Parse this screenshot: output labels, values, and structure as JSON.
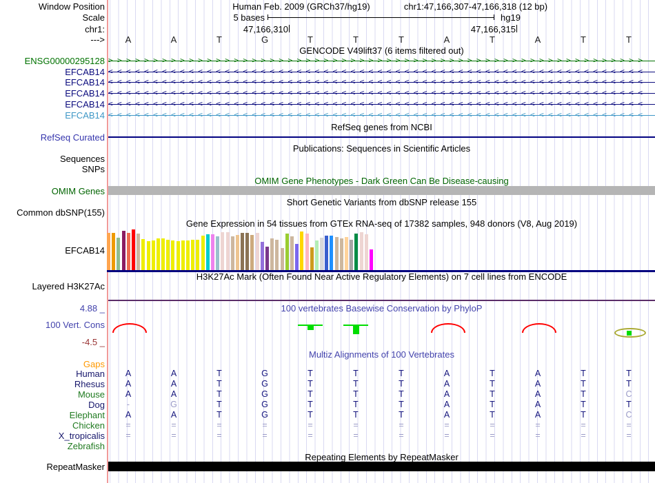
{
  "header": {
    "assembly": "Human Feb. 2009 (GRCh37/hg19)",
    "position": "chr1:47,166,307-47,166,318 (12 bp)",
    "scale_label": "5 bases",
    "genome": "hg19",
    "ruler_tick_left": "47,166,310",
    "ruler_tick_right": "47,166,315",
    "strand": "--->",
    "row_labels": {
      "window_position": "Window Position",
      "scale": "Scale",
      "chromosome": "chr1:"
    }
  },
  "sequence": {
    "bases": [
      "A",
      "A",
      "T",
      "G",
      "T",
      "T",
      "T",
      "A",
      "T",
      "A",
      "T",
      "T"
    ]
  },
  "tracks": {
    "gencode": {
      "title": "GENCODE V49lift37 (6 items filtered out)",
      "genes": [
        {
          "label": "ENSG00000295128",
          "color": "#007200",
          "direction": ">"
        },
        {
          "label": "EFCAB14",
          "color": "#0B0B7E",
          "direction": "<"
        },
        {
          "label": "EFCAB14",
          "color": "#0B0B7E",
          "direction": "<"
        },
        {
          "label": "EFCAB14",
          "color": "#0B0B7E",
          "direction": "<"
        },
        {
          "label": "EFCAB14",
          "color": "#0B0B7E",
          "direction": "<"
        },
        {
          "label": "EFCAB14",
          "color": "#3E97C6",
          "direction": "<"
        }
      ]
    },
    "refseq": {
      "title": "RefSeq genes from NCBI",
      "label": "RefSeq Curated",
      "label_color": "#3535AD",
      "line_color": "#000080"
    },
    "publications": {
      "title": "Publications: Sequences in Scientific Articles",
      "label_sequences": "Sequences",
      "label_snps": "SNPs"
    },
    "omim": {
      "title": "OMIM Gene Phenotypes - Dark Green Can Be Disease-causing",
      "label": "OMIM Genes",
      "color": "#006400",
      "bar_color": "#B5B5B5"
    },
    "dbsnp": {
      "title": "Short Genetic Variants from dbSNP release 155",
      "label": "Common dbSNP(155)"
    },
    "gtex": {
      "title": "Gene Expression in 54 tissues from GTEx RNA-seq of 17382 samples, 948 donors (V8, Aug 2019)",
      "label": "EFCAB14"
    },
    "h3k27ac": {
      "title": "H3K27Ac Mark (Often Found Near Active Regulatory Elements) on 7 cell lines from ENCODE",
      "label": "Layered H3K27Ac",
      "line_color": "#5B2D68"
    },
    "phylop": {
      "title": "100 vertebrates Basewise Conservation by PhyloP",
      "label": "100 Vert. Cons",
      "max_label": "4.88 _",
      "min_label": "-4.5 _",
      "features": [
        {
          "type": "arc",
          "x": 29
        },
        {
          "type": "tick",
          "x": 293,
          "h": 7
        },
        {
          "type": "tick",
          "x": 359,
          "h": 13
        },
        {
          "type": "arc",
          "x": 491
        },
        {
          "type": "arc",
          "x": 623
        },
        {
          "type": "oval",
          "x": 755
        }
      ]
    },
    "multiz": {
      "title": "Multiz Alignments of 100 Vertebrates",
      "rows": [
        {
          "species": "Gaps",
          "color": "#FF9900",
          "cells": [
            "",
            "",
            "",
            "",
            "",
            "",
            "",
            "",
            "",
            "",
            "",
            ""
          ],
          "dim": []
        },
        {
          "species": "Human",
          "color": "#16166B",
          "cells": [
            "A",
            "A",
            "T",
            "G",
            "T",
            "T",
            "T",
            "A",
            "T",
            "A",
            "T",
            "T"
          ],
          "dim": []
        },
        {
          "species": "Rhesus",
          "color": "#16166B",
          "cells": [
            "A",
            "A",
            "T",
            "G",
            "T",
            "T",
            "T",
            "A",
            "T",
            "A",
            "T",
            "T"
          ],
          "dim": []
        },
        {
          "species": "Mouse",
          "color": "#207A20",
          "cells": [
            "A",
            "A",
            "T",
            "G",
            "T",
            "T",
            "T",
            "A",
            "T",
            "A",
            "T",
            "C"
          ],
          "dim": [
            11
          ]
        },
        {
          "species": "Dog",
          "color": "#16166B",
          "cells": [
            "-",
            "G",
            "T",
            "G",
            "T",
            "T",
            "T",
            "A",
            "T",
            "A",
            "T",
            "T"
          ],
          "dim": [
            0,
            1
          ]
        },
        {
          "species": "Elephant",
          "color": "#207A20",
          "cells": [
            "A",
            "A",
            "T",
            "G",
            "T",
            "T",
            "T",
            "A",
            "T",
            "A",
            "T",
            "C"
          ],
          "dim": [
            11
          ]
        },
        {
          "species": "Chicken",
          "color": "#207A20",
          "cells": [
            "=",
            "=",
            "=",
            "=",
            "=",
            "=",
            "=",
            "=",
            "=",
            "=",
            "=",
            "="
          ],
          "dim": "all"
        },
        {
          "species": "X_tropicalis",
          "color": "#16166B",
          "cells": [
            "=",
            "=",
            "=",
            "=",
            "=",
            "=",
            "=",
            "=",
            "=",
            "=",
            "=",
            "="
          ],
          "dim": "all"
        },
        {
          "species": "Zebrafish",
          "color": "#207A20",
          "cells": [
            "",
            "",
            "",
            "",
            "",
            "",
            "",
            "",
            "",
            "",
            "",
            ""
          ],
          "dim": []
        }
      ]
    },
    "repeatmasker": {
      "title": "Repeating Elements by RepeatMasker",
      "label": "RepeatMasker"
    }
  },
  "chart_data": {
    "type": "bar",
    "title": "Gene Expression in 54 tissues from GTEx RNA-seq of 17382 samples, 948 donors (V8, Aug 2019)",
    "gene": "EFCAB14",
    "n_bars": 54,
    "ylim": [
      0,
      60
    ],
    "values": [
      54,
      54,
      47,
      57,
      54,
      59,
      53,
      45,
      42,
      43,
      46,
      46,
      44,
      43,
      42,
      43,
      43,
      44,
      44,
      50,
      52,
      52,
      49,
      55,
      55,
      49,
      51,
      54,
      54,
      51,
      54,
      41,
      34,
      46,
      44,
      32,
      53,
      49,
      38,
      56,
      53,
      33,
      43,
      47,
      50,
      50,
      48,
      46,
      48,
      44,
      53,
      55,
      52,
      30
    ],
    "colors": [
      "#FFA54F",
      "#EE9A00",
      "#8FBC8F",
      "#8B1C62",
      "#EE6A50",
      "#FF0000",
      "#CDB79E",
      "#EEEE00",
      "#EEEE00",
      "#EEEE00",
      "#EEEE00",
      "#EEEE00",
      "#EEEE00",
      "#EEEE00",
      "#EEEE00",
      "#EEEE00",
      "#EEEE00",
      "#EEEE00",
      "#EEEE00",
      "#EEEE00",
      "#00CDCD",
      "#EE82EE",
      "#9AC0CD",
      "#EED5D2",
      "#EED5D2",
      "#CDB79E",
      "#EEC591",
      "#8B7355",
      "#8B7355",
      "#CDAA7D",
      "#EED5D2",
      "#9370DB",
      "#7A378B",
      "#CDB79E",
      "#CDB79E",
      "#CDB79E",
      "#9ACD32",
      "#CDB79E",
      "#7A67EE",
      "#FFD700",
      "#FFB6C1",
      "#CD9B1D",
      "#B4EEB4",
      "#D9D9D9",
      "#3A5FCD",
      "#1E90FF",
      "#CDB79E",
      "#CDB79E",
      "#FFD39B",
      "#A6A6A6",
      "#008B45",
      "#EED5D2",
      "#EED5D2",
      "#FF00FF"
    ]
  },
  "colors": {
    "grid": "#D9D9F2",
    "marker_line": "#F19A9A",
    "title_blue": "#4242AC",
    "phylop_pos": "#00DD00",
    "phylop_neg": "#FF0000",
    "phylop_oval": "#AAAA33",
    "maroon": "#993333",
    "letter": "#14147D",
    "letter_dim": "#9A9AC8"
  }
}
